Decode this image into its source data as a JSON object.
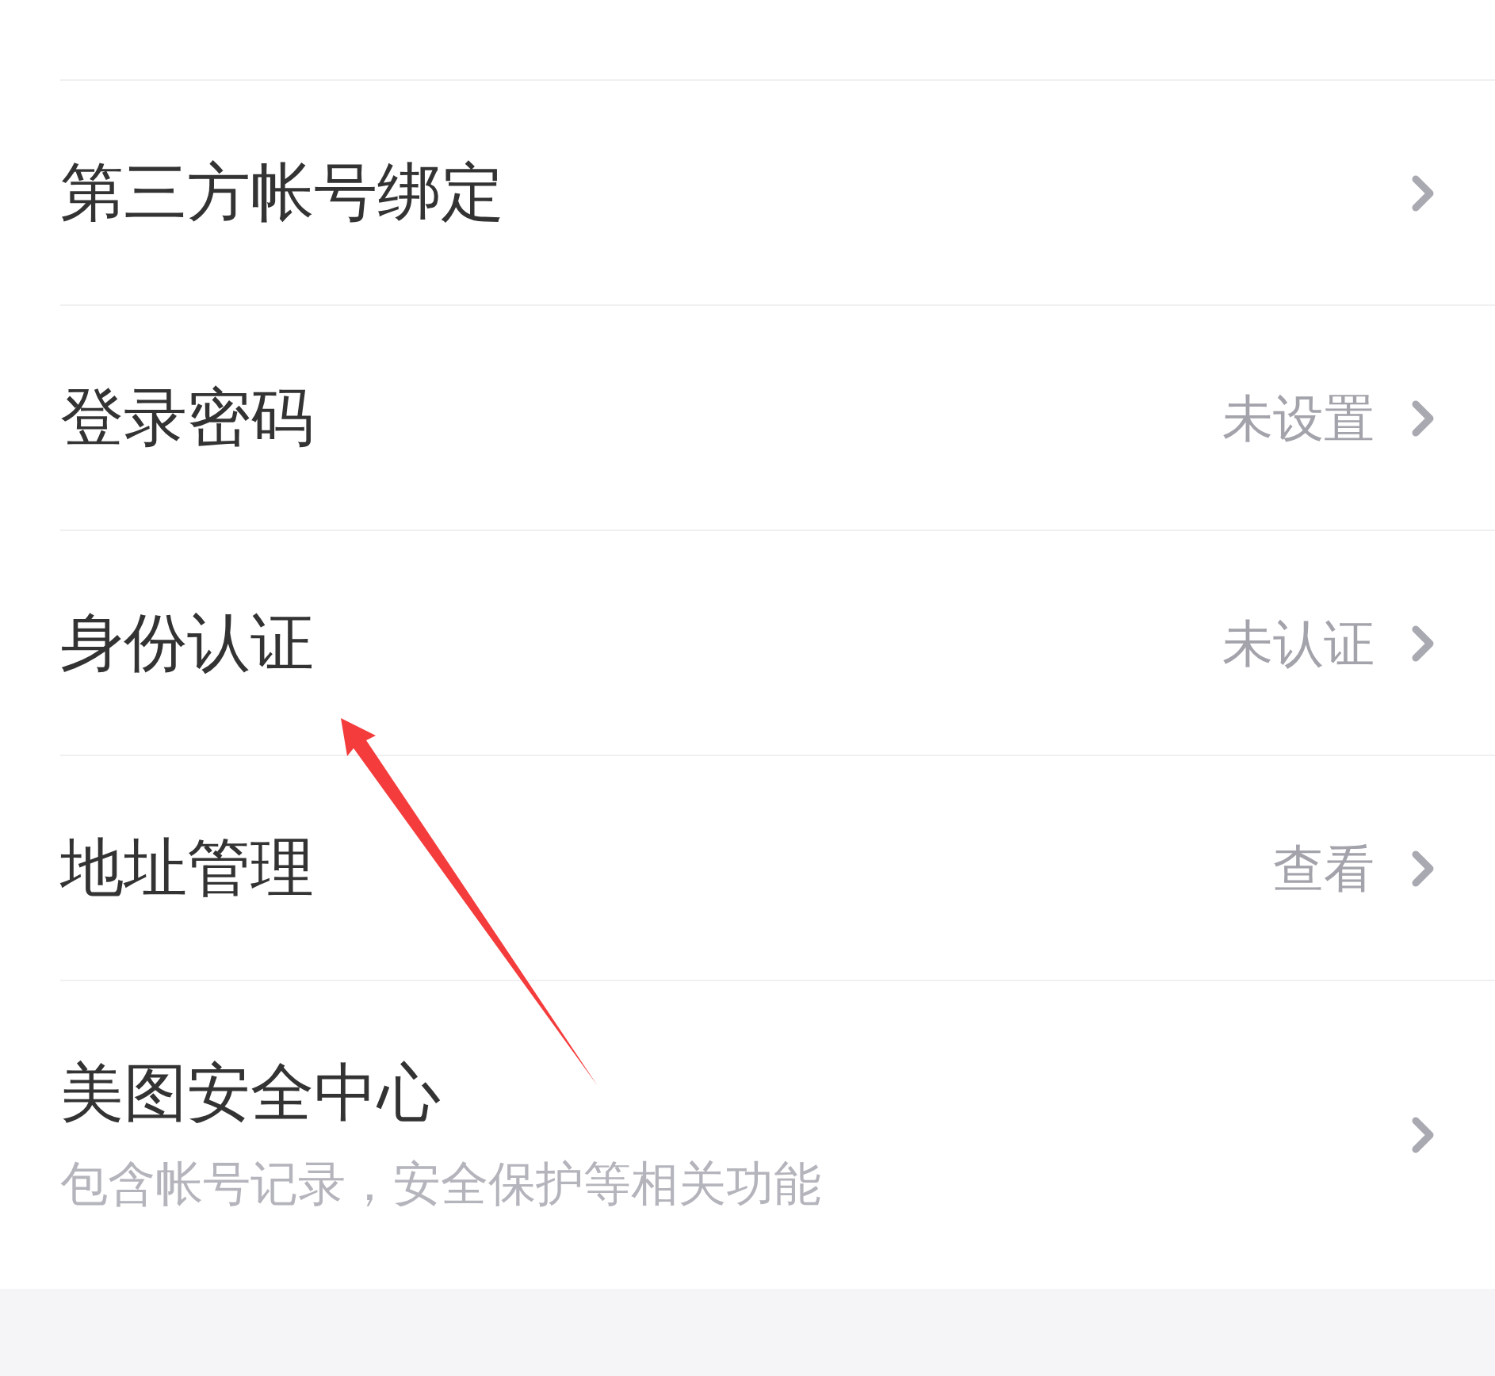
{
  "rows": [
    {
      "title": "第三方帐号绑定"
    },
    {
      "title": "登录密码",
      "value": "未设置"
    },
    {
      "title": "身份认证",
      "value": "未认证"
    },
    {
      "title": "地址管理",
      "value": "查看"
    },
    {
      "title": "美图安全中心",
      "description": "包含帐号记录，安全保护等相关功能"
    }
  ]
}
